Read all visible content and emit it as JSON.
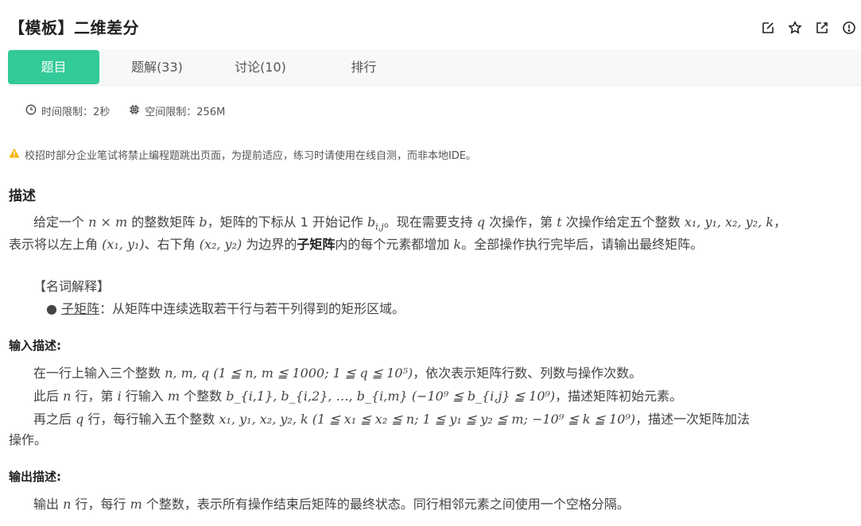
{
  "header": {
    "title": "【模板】二维差分",
    "icons": [
      "edit-icon",
      "star-icon",
      "external-link-icon",
      "info-icon"
    ]
  },
  "tabs": [
    {
      "label": "题目",
      "active": true
    },
    {
      "label": "题解(33)",
      "active": false
    },
    {
      "label": "讨论(10)",
      "active": false
    },
    {
      "label": "排行",
      "active": false
    }
  ],
  "meta": {
    "time_limit": "时间限制：2秒",
    "memory_limit": "空间限制：256M"
  },
  "notice": "校招时部分企业笔试将禁止编程题跳出页面，为提前适应，练习时请使用在线自测，而非本地IDE。",
  "colors": {
    "accent": "#32ca99",
    "warning": "#f5b400"
  },
  "description": {
    "heading": "描述",
    "line1_parts": [
      "给定一个 ",
      "n × m",
      " 的整数矩阵 ",
      "b",
      "，矩阵的下标从 1 开始记作 ",
      "b",
      "i,j",
      "。现在需要支持 ",
      "q",
      " 次操作，第 ",
      "t",
      " 次操作给定五个整数 ",
      "x₁, y₁, x₂, y₂, k",
      "，"
    ],
    "line2_parts": [
      "表示将以左上角 ",
      "(x₁, y₁)",
      "、右下角 ",
      "(x₂, y₂)",
      " 为边界的",
      "子矩阵",
      "内的每个元素都增加 ",
      "k",
      "。全部操作执行完毕后，请输出最终矩阵。"
    ],
    "glossary_title": "【名词解释】",
    "glossary_term": "子矩阵",
    "glossary_def": "：从矩阵中连续选取若干行与若干列得到的矩形区域。"
  },
  "input": {
    "heading": "输入描述:",
    "line1_a": "在一行上输入三个整数 ",
    "line1_math": "n, m, q (1 ≦ n, m ≦ 1000; 1 ≦ q ≦ 10⁵)",
    "line1_b": "，依次表示矩阵行数、列数与操作次数。",
    "line2_a": "此后 ",
    "line2_n": "n",
    "line2_b": " 行，第 ",
    "line2_i": "i",
    "line2_c": " 行输入 ",
    "line2_m": "m",
    "line2_d": " 个整数 ",
    "line2_math": "b_{i,1}, b_{i,2}, …, b_{i,m} (−10⁹ ≦ b_{i,j} ≦ 10⁹)",
    "line2_e": "，描述矩阵初始元素。",
    "line3_a": "再之后 ",
    "line3_q": "q",
    "line3_b": " 行，每行输入五个整数 ",
    "line3_math": "x₁, y₁, x₂, y₂, k (1 ≦ x₁ ≦ x₂ ≦ n; 1 ≦ y₁ ≦ y₂ ≦ m; −10⁹ ≦ k ≦ 10⁹)",
    "line3_c": "，描述一次矩阵加法",
    "line4": "操作。"
  },
  "output": {
    "heading": "输出描述:",
    "line_a": "输出 ",
    "line_n": "n",
    "line_b": " 行，每行 ",
    "line_m": "m",
    "line_c": " 个整数，表示所有操作结束后矩阵的最终状态。同行相邻元素之间使用一个空格分隔。"
  }
}
